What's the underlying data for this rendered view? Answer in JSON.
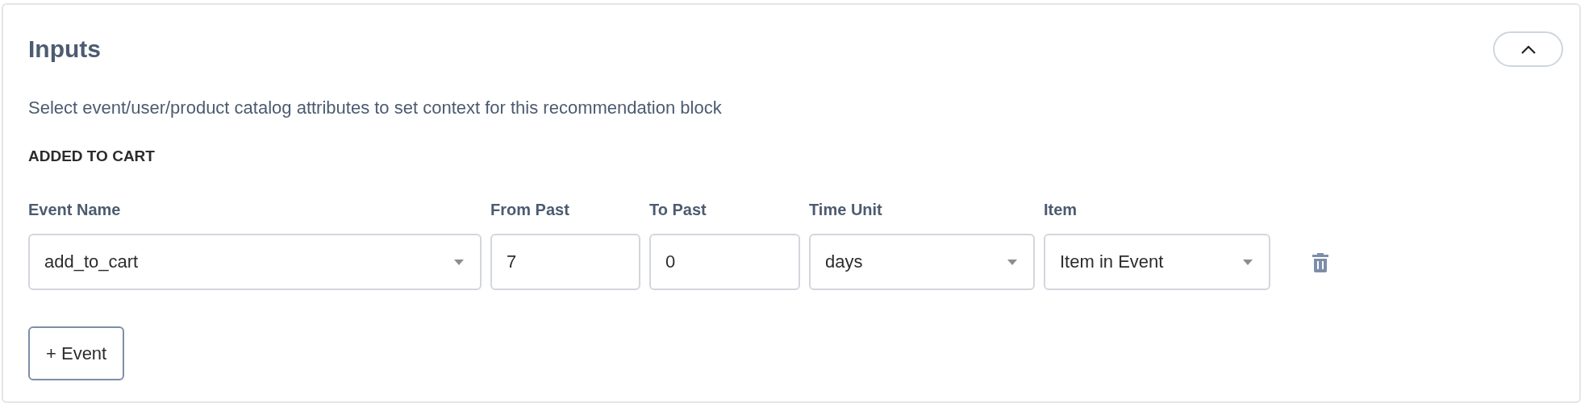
{
  "panel": {
    "title": "Inputs",
    "expanded": true,
    "description": "Select event/user/product catalog attributes to set context for this recommendation block",
    "section": "ADDED TO CART",
    "fields": [
      {
        "kind": "select",
        "label": "Event Name",
        "value": "add_to_cart"
      },
      {
        "kind": "input",
        "label": "From Past",
        "value": "7"
      },
      {
        "kind": "input",
        "label": "To Past",
        "value": "0"
      },
      {
        "kind": "select",
        "label": "Time Unit",
        "value": "days"
      },
      {
        "kind": "select",
        "label": "Item",
        "value": "Item in Event"
      }
    ],
    "add_button": "+ Event"
  }
}
